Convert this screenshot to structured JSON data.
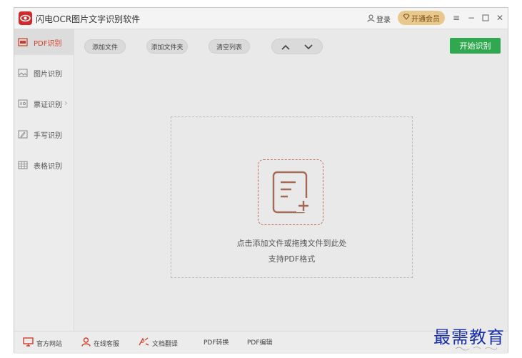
{
  "app": {
    "title": "闪电OCR图片文字识别软件"
  },
  "header": {
    "login_label": "登录",
    "vip_label": "开通会员"
  },
  "sidebar": {
    "items": [
      {
        "label": "PDF识别",
        "icon": "pdf-icon",
        "active": true
      },
      {
        "label": "图片识别",
        "icon": "image-icon",
        "active": false
      },
      {
        "label": "票证识别",
        "icon": "id-card-icon",
        "active": false
      },
      {
        "label": "手写识别",
        "icon": "handwriting-icon",
        "active": false
      },
      {
        "label": "表格识别",
        "icon": "table-icon",
        "active": false
      }
    ]
  },
  "toolbar": {
    "add_file": "添加文件",
    "add_folder": "添加文件夹",
    "clear_list": "清空列表",
    "start": "开始识别"
  },
  "dropzone": {
    "hint": "点击添加文件或拖拽文件到此处",
    "support": "支持PDF格式"
  },
  "bottombar": {
    "website": "官方网站",
    "service": "在线客服",
    "translate": "文档翻译",
    "pdf_convert": "PDF转换",
    "pdf_edit": "PDF编辑"
  },
  "watermark": {
    "text": "最需教育"
  },
  "colors": {
    "accent_red": "#d43b2a",
    "start_green": "#2fa84f",
    "vip_gold": "#e8c98d"
  }
}
